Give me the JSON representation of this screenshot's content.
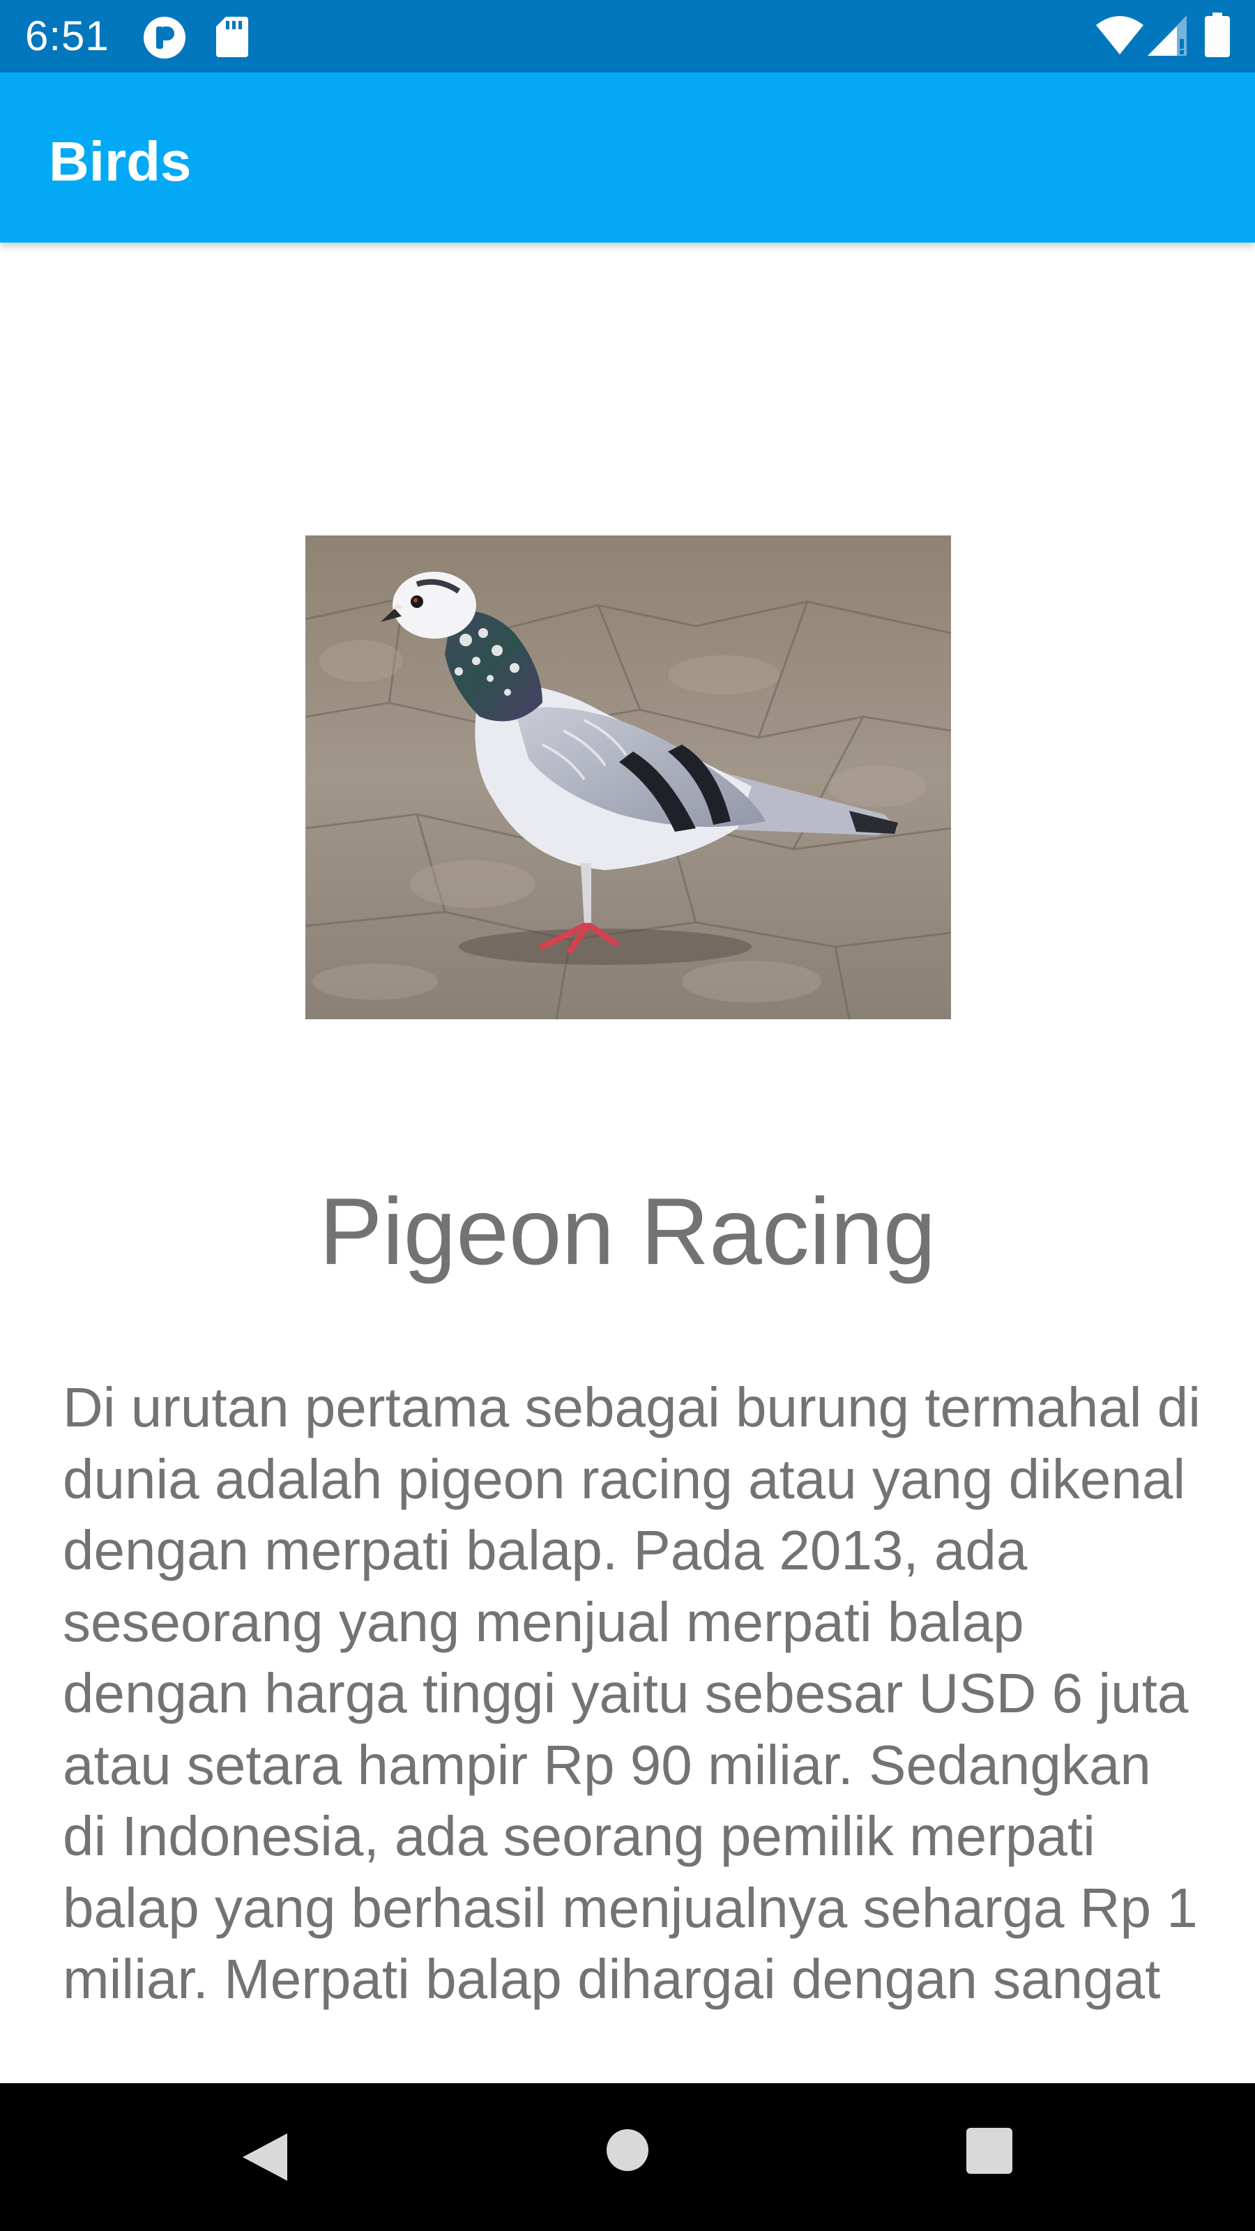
{
  "status_bar": {
    "time": "6:51",
    "icons": [
      "app-notification-icon",
      "sd-card-icon",
      "wifi-icon",
      "cell-signal-icon",
      "battery-icon"
    ],
    "background": "#0277bd"
  },
  "app_bar": {
    "title": "Birds",
    "background": "#03a9f4"
  },
  "detail": {
    "image": "pigeon-photo",
    "name": "Pigeon Racing",
    "description": "Di urutan pertama sebagai burung termahal di dunia adalah pigeon racing atau yang dikenal dengan merpati balap. Pada 2013, ada seseorang yang menjual merpati balap dengan harga tinggi yaitu sebesar USD 6 juta atau setara hampir Rp 90 miliar. Sedangkan di Indonesia, ada seorang pemilik merpati balap yang berhasil menjualnya seharga Rp 1 miliar. Merpati balap dihargai dengan sangat",
    "text_color": "#737373"
  },
  "nav_bar": {
    "buttons": [
      "back-icon",
      "home-icon",
      "recents-icon"
    ]
  }
}
